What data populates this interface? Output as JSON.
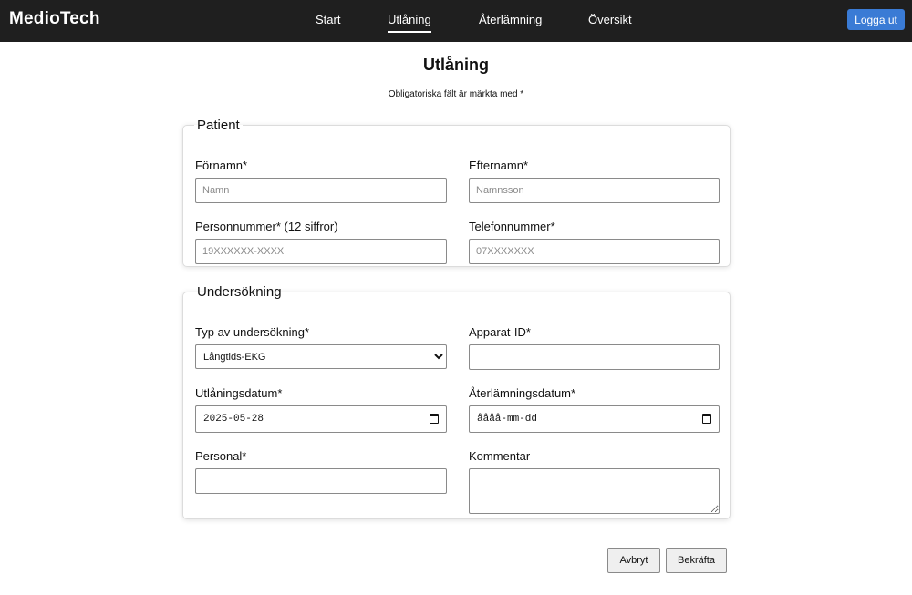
{
  "app": {
    "brand": "MedioTech"
  },
  "nav": {
    "start": "Start",
    "loan": "Utlåning",
    "return": "Återlämning",
    "overview": "Översikt"
  },
  "header": {
    "logout_label": "Logga ut"
  },
  "page": {
    "title": "Utlåning",
    "required_note": "Obligatoriska fält är märkta med *"
  },
  "patient": {
    "legend": "Patient",
    "first_name": {
      "label": "Förnamn*",
      "placeholder": "Namn",
      "value": ""
    },
    "last_name": {
      "label": "Efternamn*",
      "placeholder": "Namnsson",
      "value": ""
    },
    "personal_number": {
      "label": "Personnummer* (12 siffror)",
      "placeholder": "19XXXXXX-XXXX",
      "value": ""
    },
    "phone": {
      "label": "Telefonnummer*",
      "placeholder": "07XXXXXXX",
      "value": ""
    }
  },
  "exam": {
    "legend": "Undersökning",
    "type": {
      "label": "Typ av undersökning*",
      "selected": "Långtids-EKG"
    },
    "device_id": {
      "label": "Apparat-ID*",
      "value": ""
    },
    "loan_date": {
      "label": "Utlåningsdatum*",
      "value": "2025-05-28"
    },
    "return_date": {
      "label": "Återlämningsdatum*",
      "value": "åååå-mm-dd"
    },
    "staff": {
      "label": "Personal*",
      "value": ""
    },
    "comment": {
      "label": "Kommentar",
      "value": ""
    }
  },
  "actions": {
    "cancel_label": "Avbryt",
    "confirm_label": "Bekräfta"
  },
  "colors": {
    "topbar": "#1f1f1f",
    "accent": "#3a7bd5",
    "background": "#ffffff"
  },
  "icons": {
    "date_picker": "calendar-icon",
    "select": "chevron-down-icon"
  }
}
